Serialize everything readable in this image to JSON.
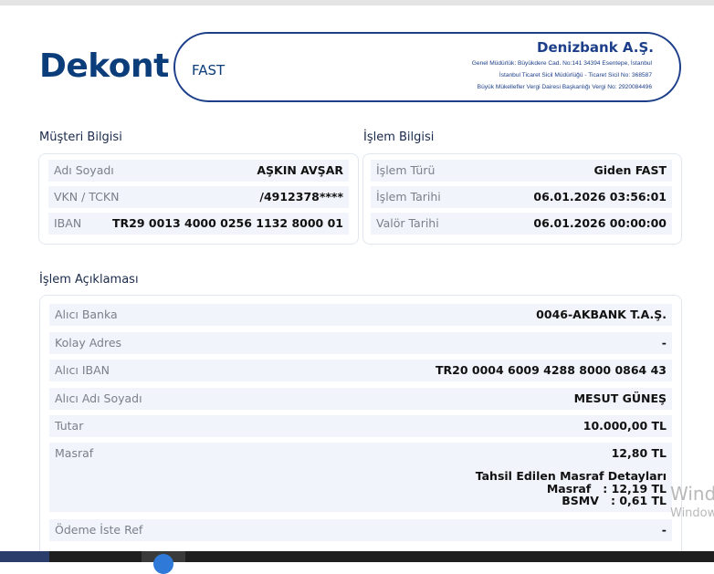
{
  "header": {
    "title": "Dekont",
    "transaction_type": "FAST",
    "bank_name": "Denizbank A.Ş.",
    "address_lines": [
      "Genel Müdürlük: Büyükdere Cad. No:141 34394 Esentepe, İstanbul",
      "İstanbul Ticaret Sicil Müdürlüğü - Ticaret Sicil No: 368587",
      "Büyük Mükellefler Vergi Dairesi Başkanlığı Vergi No: 2920084496"
    ]
  },
  "customer": {
    "section_title": "Müşteri Bilgisi",
    "rows": [
      {
        "label": "Adı Soyadı",
        "value": "AŞKIN AVŞAR"
      },
      {
        "label": "VKN / TCKN",
        "value": "/4912378****"
      },
      {
        "label": "IBAN",
        "value": "TR29 0013 4000 0256 1132 8000 01"
      }
    ]
  },
  "transaction": {
    "section_title": "İşlem Bilgisi",
    "rows": [
      {
        "label": "İşlem Türü",
        "value": "Giden FAST"
      },
      {
        "label": "İşlem Tarihi",
        "value": "06.01.2026 03:56:01"
      },
      {
        "label": "Valör Tarihi",
        "value": "06.01.2026 00:00:00"
      }
    ]
  },
  "description": {
    "section_title": "İşlem Açıklaması",
    "rows": [
      {
        "label": "Alıcı Banka",
        "value": "0046-AKBANK T.A.Ş."
      },
      {
        "label": "Kolay Adres",
        "value": "-"
      },
      {
        "label": "Alıcı IBAN",
        "value": "TR20 0004 6009 4288 8000 0864 43"
      },
      {
        "label": "Alıcı Adı Soyadı",
        "value": "MESUT GÜNEŞ"
      },
      {
        "label": "Tutar",
        "value": "10.000,00 TL"
      },
      {
        "label": "Masraf",
        "value": "12,80 TL"
      },
      {
        "label": "Ödeme İste Ref",
        "value": "-"
      }
    ],
    "fee_details": {
      "title": "Tahsil Edilen Masraf Detayları",
      "line1": "Masraf   : 12,19 TL",
      "line2": "BSMV   : 0,61 TL"
    }
  },
  "watermark": {
    "line1": "Wind",
    "line2": "Window"
  }
}
